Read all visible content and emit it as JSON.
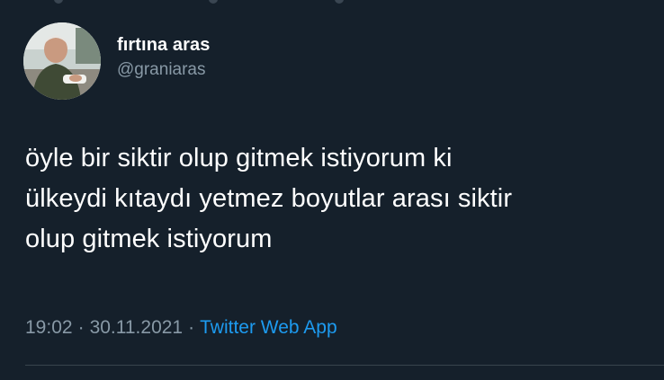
{
  "tweet": {
    "author": {
      "display_name": "fırtına aras",
      "handle": "@graniaras"
    },
    "text_lines": [
      "öyle bir siktir olup gitmek istiyorum ki",
      "ülkeydi kıtaydı yetmez boyutlar arası siktir",
      "olup gitmek istiyorum"
    ],
    "time": "19:02",
    "separator": "·",
    "date": "30.11.2021",
    "source": "Twitter Web App"
  },
  "colors": {
    "background": "#15202b",
    "primary_text": "#ffffff",
    "secondary_text": "#8899a6",
    "link": "#1d9bf0",
    "divider": "#38444d"
  }
}
